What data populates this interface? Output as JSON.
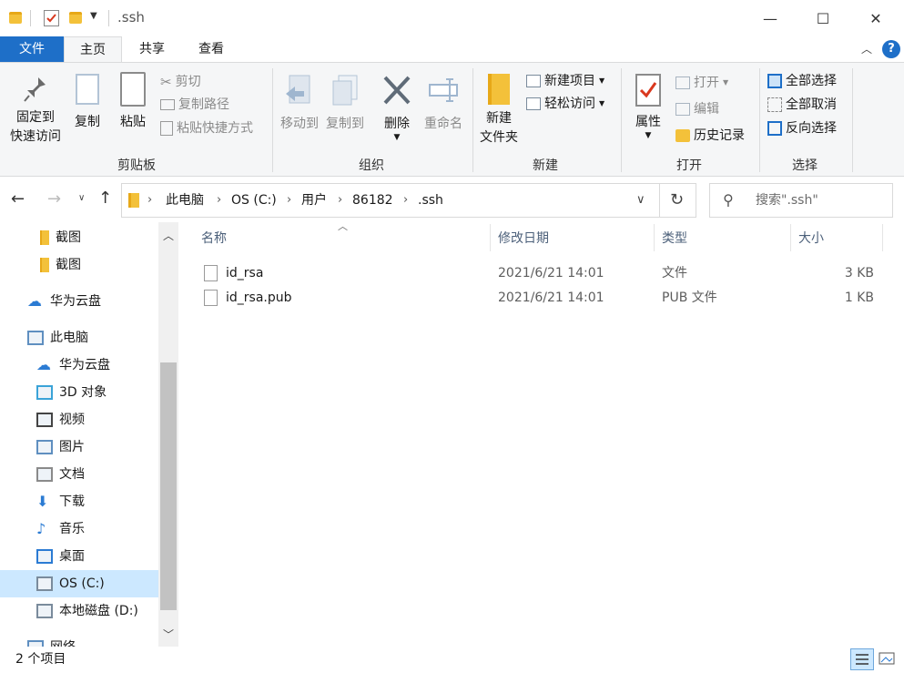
{
  "window": {
    "title": ".ssh",
    "minimize": "—",
    "maximize": "☐",
    "close": "✕"
  },
  "ribbon_tabs": [
    "文件",
    "主页",
    "共享",
    "查看"
  ],
  "ribbon": {
    "clipboard": {
      "label": "剪贴板",
      "pin_line1": "固定到",
      "pin_line2": "快速访问",
      "copy": "复制",
      "paste": "粘贴",
      "cut": "剪切",
      "copy_path": "复制路径",
      "paste_shortcut": "粘贴快捷方式"
    },
    "organize": {
      "label": "组织",
      "move_to": "移动到",
      "copy_to": "复制到",
      "delete": "删除",
      "rename": "重命名"
    },
    "new": {
      "label": "新建",
      "new_folder_line1": "新建",
      "new_folder_line2": "文件夹",
      "new_item": "新建项目",
      "easy_access": "轻松访问"
    },
    "open": {
      "label": "打开",
      "properties": "属性",
      "open": "打开",
      "edit": "编辑",
      "history": "历史记录"
    },
    "select": {
      "label": "选择",
      "select_all": "全部选择",
      "select_none": "全部取消",
      "invert": "反向选择"
    }
  },
  "address": {
    "crumbs": [
      "此电脑",
      "OS (C:)",
      "用户",
      "86182",
      ".ssh"
    ]
  },
  "search": {
    "placeholder": "搜索\".ssh\""
  },
  "nav_pane": [
    {
      "label": "截图",
      "icon": "folder-icon",
      "indent": 1
    },
    {
      "label": "截图",
      "icon": "folder-icon",
      "indent": 1
    },
    {
      "label": "华为云盘",
      "icon": "cloud-icon",
      "indent": 0
    },
    {
      "label": "此电脑",
      "icon": "computer-icon",
      "indent": 0
    },
    {
      "label": "华为云盘",
      "icon": "cloud-icon",
      "indent": 1
    },
    {
      "label": "3D 对象",
      "icon": "cube-icon",
      "indent": 1
    },
    {
      "label": "视频",
      "icon": "video-icon",
      "indent": 1
    },
    {
      "label": "图片",
      "icon": "picture-icon",
      "indent": 1
    },
    {
      "label": "文档",
      "icon": "document-icon",
      "indent": 1
    },
    {
      "label": "下载",
      "icon": "download-icon",
      "indent": 1
    },
    {
      "label": "音乐",
      "icon": "music-icon",
      "indent": 1
    },
    {
      "label": "桌面",
      "icon": "desktop-icon",
      "indent": 1
    },
    {
      "label": "OS (C:)",
      "icon": "drive-c-icon",
      "indent": 1,
      "selected": true
    },
    {
      "label": "本地磁盘 (D:)",
      "icon": "drive-d-icon",
      "indent": 1
    },
    {
      "label": "网络",
      "icon": "network-icon",
      "indent": 0
    }
  ],
  "columns": [
    "名称",
    "修改日期",
    "类型",
    "大小"
  ],
  "files": [
    {
      "name": "id_rsa",
      "modified": "2021/6/21 14:01",
      "type": "文件",
      "size": "3 KB"
    },
    {
      "name": "id_rsa.pub",
      "modified": "2021/6/21 14:01",
      "type": "PUB 文件",
      "size": "1 KB"
    }
  ],
  "status": {
    "count": "2 个项目"
  },
  "colors": {
    "accent": "#1e6fc8",
    "folder": "#f3c13a",
    "selected_nav": "#cce8ff"
  }
}
